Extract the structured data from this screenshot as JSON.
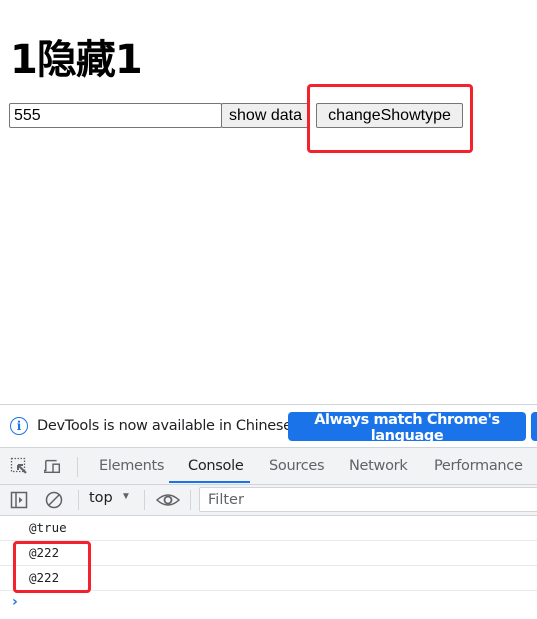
{
  "page": {
    "heading": "1隐藏1",
    "input_value": "555",
    "show_data_label": "show data",
    "change_showtype_label": "changeShowtype"
  },
  "devtools": {
    "infobar": {
      "message": "DevTools is now available in Chinese!",
      "match_language_label": "Always match Chrome's language"
    },
    "tabs": [
      {
        "label": "Elements",
        "active": false
      },
      {
        "label": "Console",
        "active": true
      },
      {
        "label": "Sources",
        "active": false
      },
      {
        "label": "Network",
        "active": false
      },
      {
        "label": "Performance",
        "active": false
      }
    ],
    "toolbar": {
      "context": "top",
      "filter_placeholder": "Filter"
    },
    "console_logs": [
      "@true",
      "@222",
      "@222"
    ],
    "prompt": "›"
  },
  "colors": {
    "accent": "#1a73e8",
    "annotation": "#f5222d"
  }
}
